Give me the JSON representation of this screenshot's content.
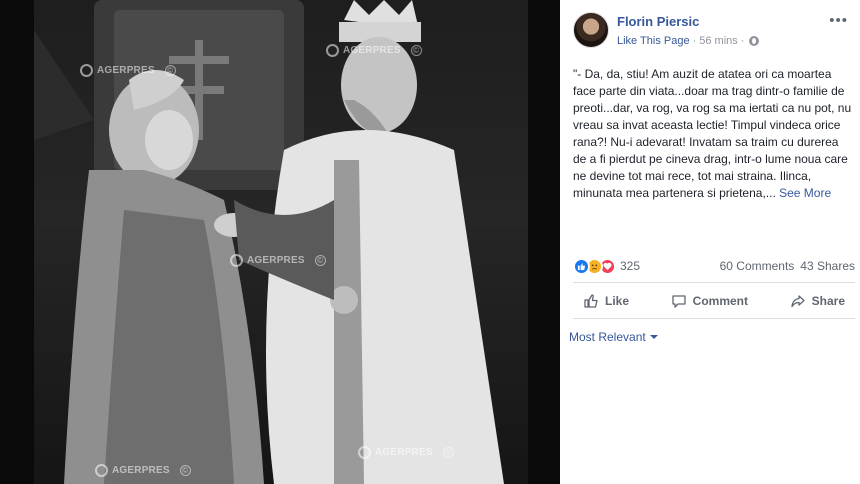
{
  "post": {
    "author": "Florin Piersic",
    "like_page": "Like This Page",
    "time": "56 mins",
    "separator": "·",
    "text": "\"- Da, da, stiu! Am auzit de atatea ori ca moartea face parte din viata...doar ma trag dintr-o familie de preoti...dar, va rog, va rog sa ma iertati ca nu pot, nu vreau sa invat aceasta lectie! Timpul vindeca orice rana?! Nu-i adevarat! Invatam sa traim cu durerea de a fi pierdut pe cineva drag, intr-o lume noua care ne devine tot mai rece, tot mai straina. Ilinca, minunata mea partenera si prietena,...",
    "see_more": "See More"
  },
  "stats": {
    "reaction_count": "325",
    "comments": "60 Comments",
    "shares": "43 Shares"
  },
  "reactions": [
    "like",
    "sad",
    "love"
  ],
  "actions": {
    "like": "Like",
    "comment": "Comment",
    "share": "Share"
  },
  "comments_filter": "Most Relevant",
  "watermarks": [
    "AGERPRES",
    "AGERPRES",
    "AGERPRES",
    "AGERPRES",
    "AGERPRES"
  ],
  "colors": {
    "link": "#365899",
    "secondary_text": "#606770",
    "like_blue": "#1877f2",
    "love_red": "#f33e58",
    "sad_yellow": "#f7b125"
  },
  "icons": {
    "close": "close-icon",
    "privacy": "globe-icon",
    "like": "thumbs-up-icon",
    "comment": "speech-bubble-icon",
    "share": "share-arrow-icon",
    "dropdown": "caret-down-icon"
  }
}
